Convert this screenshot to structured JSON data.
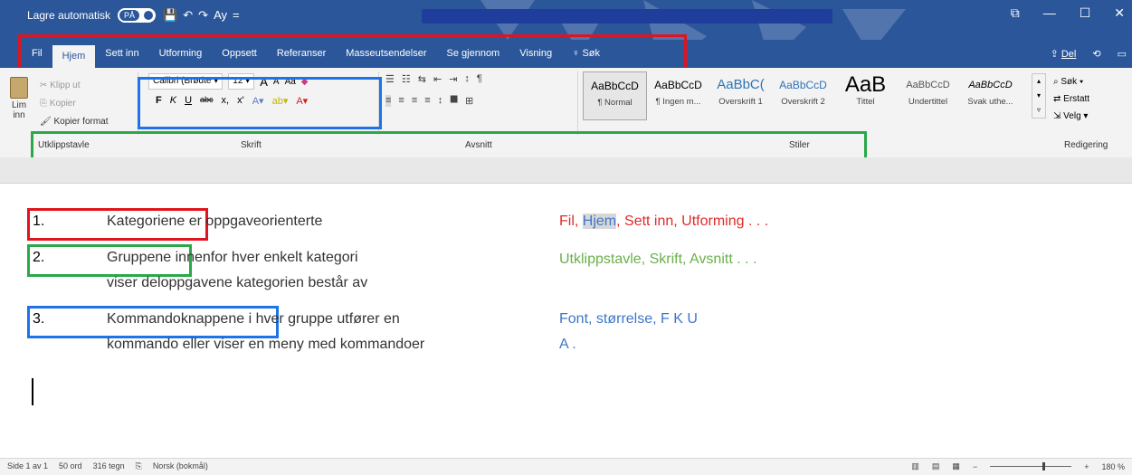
{
  "title_bar": {
    "autosave_label": "Lagre automatisk",
    "autosave_state": "PÅ",
    "qat": [
      "💾",
      "↶",
      "↷",
      "Ay",
      "="
    ],
    "window_controls": [
      "⧉",
      "—",
      "☐",
      "✕"
    ]
  },
  "menu": {
    "tabs": [
      "Fil",
      "Hjem",
      "Sett inn",
      "Utforming",
      "Oppsett",
      "Referanser",
      "Masseutsendelser",
      "Se gjennom",
      "Visning",
      "Søk"
    ],
    "search_prefix": "♀",
    "share_label": "Del"
  },
  "ribbon": {
    "clipboard": {
      "paste": "Lim inn",
      "cut": "Klipp ut",
      "copy": "Kopier",
      "format_painter": "Kopier format"
    },
    "font": {
      "name": "Calibri (Brødte",
      "size": "12",
      "grow": "A",
      "shrink": "A",
      "case": "Aa",
      "bold": "F",
      "italic": "K",
      "underline": "U",
      "strike": "abc",
      "sub": "x,",
      "sup": "x'"
    },
    "paragraph": {
      "row1": [
        "☰",
        "☷",
        "⇆",
        "⇤",
        "⇥",
        "↕",
        "¶"
      ],
      "row2": [
        "≡",
        "≡",
        "≡",
        "≡",
        "↕",
        "⯀",
        "⊞"
      ]
    },
    "styles": [
      {
        "sample": "AaBbCcD",
        "name": "¶ Normal"
      },
      {
        "sample": "AaBbCcD",
        "name": "¶ Ingen m..."
      },
      {
        "sample": "AaBbC(",
        "name": "Overskrift 1"
      },
      {
        "sample": "AaBbCcD",
        "name": "Overskrift 2"
      },
      {
        "sample": "AaB",
        "name": "Tittel"
      },
      {
        "sample": "AaBbCcD",
        "name": "Undertittel"
      },
      {
        "sample": "AaBbCcD",
        "name": "Svak uthe..."
      }
    ],
    "editing": {
      "find": "Søk",
      "replace": "Erstatt",
      "select": "Velg"
    },
    "group_labels": {
      "clipboard": "Utklippstavle",
      "font": "Skrift",
      "paragraph": "Avsnitt",
      "styles": "Stiler",
      "editing": "Redigering"
    }
  },
  "document": {
    "items": [
      {
        "num": "1.",
        "word": "Kategoriene",
        "rest": "er oppgaveorienterte",
        "line2": ""
      },
      {
        "num": "2.",
        "word": "Gruppene",
        "rest": "innenfor hver enkelt kategori",
        "line2": "viser deloppgavene kategorien består av"
      },
      {
        "num": "3.",
        "word": "Kommandoknappene",
        "rest": "i hver gruppe utfører en",
        "line2": "kommando eller viser en meny med kommandoer"
      }
    ],
    "annotations": {
      "red_pre": "Fil, ",
      "red_highlight": "Hjem",
      "red_post": ", Sett inn, Utforming . . .",
      "green": "Utklippstavle, Skrift, Avsnitt . . .",
      "blue": "Font, størrelse, F  K  U",
      "blue_suffix": "A ."
    }
  },
  "status_bar": {
    "page": "Side 1 av 1",
    "words": "50 ord",
    "chars": "316 tegn",
    "language": "Norsk (bokmål)",
    "zoom": "180 %"
  }
}
